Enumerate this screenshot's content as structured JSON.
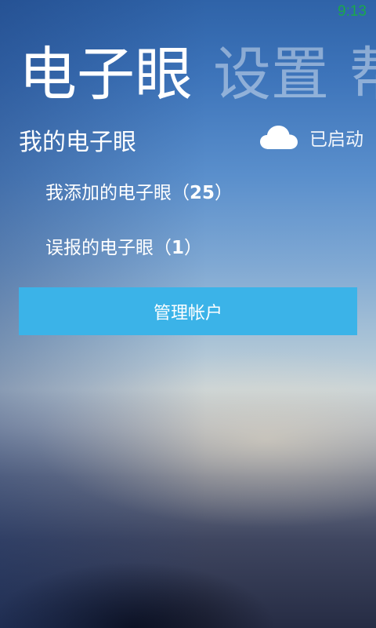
{
  "status_bar": {
    "time": "9:13"
  },
  "pivot": {
    "items": [
      {
        "label": "电子眼"
      },
      {
        "label": "设置"
      },
      {
        "label": "帮"
      }
    ]
  },
  "section": {
    "title": "我的电子眼",
    "status_icon": "cloud-icon",
    "status_text": "已启动"
  },
  "lists": {
    "added": {
      "label": "我添加的电子眼（",
      "count": "25",
      "close": "）"
    },
    "false_reports": {
      "label": "误报的电子眼（",
      "count": "1",
      "close": "）"
    }
  },
  "button": {
    "label": "管理帐户"
  },
  "colors": {
    "accent": "#3bb3e8",
    "status_time": "#1aa84a"
  }
}
